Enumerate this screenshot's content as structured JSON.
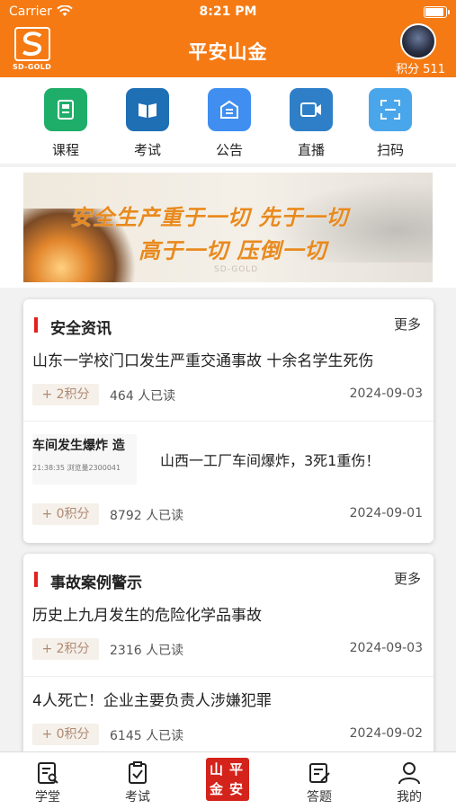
{
  "status_bar": {
    "carrier": "Carrier",
    "time": "8:21 PM"
  },
  "header": {
    "logo_text": "SD-GOLD",
    "title": "平安山金",
    "points_label": "积分",
    "points_value": "511",
    "brand_color": "#f57a14"
  },
  "quick_menu": [
    {
      "label": "课程",
      "icon": "course-icon",
      "color": "#1fae6a"
    },
    {
      "label": "考试",
      "icon": "exam-book-icon",
      "color": "#1f6fb5"
    },
    {
      "label": "公告",
      "icon": "notice-icon",
      "color": "#3f8ef0"
    },
    {
      "label": "直播",
      "icon": "live-camera-icon",
      "color": "#2f7fc8"
    },
    {
      "label": "扫码",
      "icon": "scan-icon",
      "color": "#4aa6ea"
    }
  ],
  "banner": {
    "line1": "安全生产重于一切  先于一切",
    "line2": "高于一切  压倒一切",
    "watermark": "SD-GOLD"
  },
  "sections": [
    {
      "title": "安全资讯",
      "more": "更多",
      "articles": [
        {
          "title": "山东一学校门口发生严重交通事故 十余名学生死伤",
          "points": "+ 2积分",
          "reads": "464 人已读",
          "date": "2024-09-03"
        },
        {
          "title": "山西一工厂车间爆炸，3死1重伤！",
          "thumb_title": "车间发生爆炸 造",
          "thumb_sub": "21:38:35  浏览量2300041",
          "points": "+ 0积分",
          "reads": "8792 人已读",
          "date": "2024-09-01"
        }
      ]
    },
    {
      "title": "事故案例警示",
      "more": "更多",
      "articles": [
        {
          "title": "历史上九月发生的危险化学品事故",
          "points": "+ 2积分",
          "reads": "2316 人已读",
          "date": "2024-09-03"
        },
        {
          "title": "4人死亡！企业主要负责人涉嫌犯罪",
          "points": "+ 0积分",
          "reads": "6145 人已读",
          "date": "2024-09-02"
        }
      ]
    }
  ],
  "tabbar": [
    {
      "label": "学堂",
      "icon": "study-icon"
    },
    {
      "label": "考试",
      "icon": "exam-icon"
    },
    {
      "label": "",
      "icon": "pingan-shanjin-logo",
      "seal": [
        "山",
        "平",
        "金",
        "安"
      ]
    },
    {
      "label": "答题",
      "icon": "quiz-icon"
    },
    {
      "label": "我的",
      "icon": "profile-icon"
    }
  ]
}
